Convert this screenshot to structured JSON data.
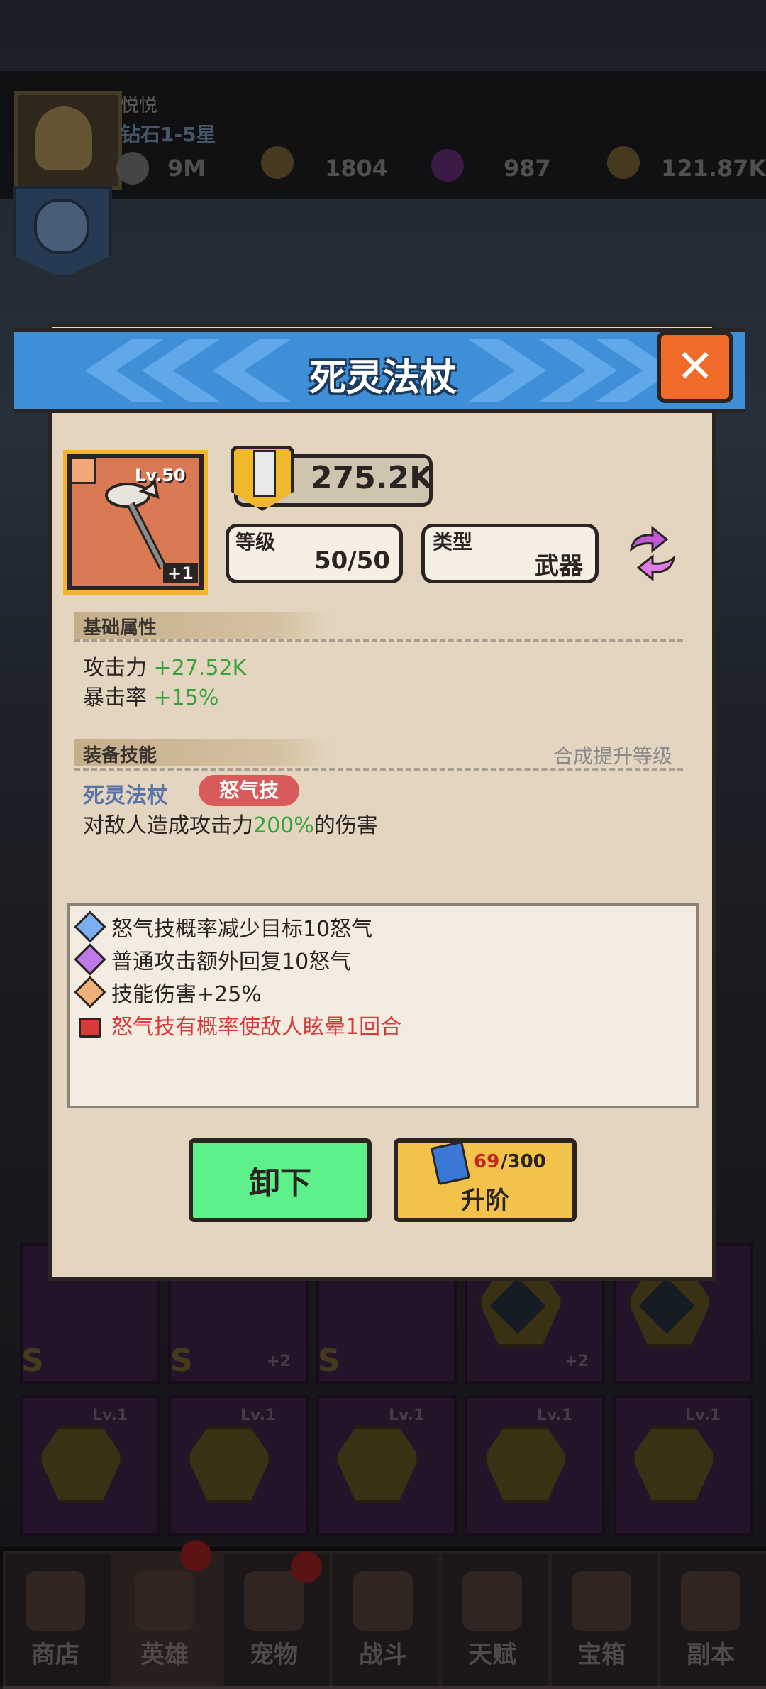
{
  "header": {
    "player_name": "悦悦",
    "rank": "钻石1-5星",
    "resources": [
      {
        "icon": "trophy-icon",
        "value": "9M"
      },
      {
        "icon": "gold-hero-icon",
        "value": "1804"
      },
      {
        "icon": "purple-potion-icon",
        "value": "987"
      },
      {
        "icon": "gold-coin-icon",
        "value": "121.87K"
      }
    ]
  },
  "dialog": {
    "title": "死灵法杖",
    "close_icon": "close-icon",
    "item": {
      "level": "Lv.50",
      "plus": "+1",
      "icon": "necro-staff-icon"
    },
    "power": "275.2K",
    "level_box": {
      "label": "等级",
      "value": "50/50"
    },
    "type_box": {
      "label": "类型",
      "value": "武器"
    },
    "base_attrs": {
      "title": "基础属性",
      "rows": [
        {
          "name": "攻击力",
          "value": "+27.52K"
        },
        {
          "name": "暴击率",
          "value": "+15%"
        }
      ]
    },
    "skill": {
      "title": "装备技能",
      "hint": "合成提升等级",
      "name": "死灵法杖",
      "tag": "怒气技",
      "desc_pre": "对敌人造成攻击力",
      "desc_pct": "200%",
      "desc_post": "的伤害"
    },
    "effects": [
      {
        "text": "怒气技概率减少目标10怒气",
        "color": "#7ab0f0",
        "locked": false
      },
      {
        "text": "普通攻击额外回复10怒气",
        "color": "#c07ae8",
        "locked": false
      },
      {
        "text": "技能伤害+25%",
        "color": "#f0b07a",
        "locked": false
      },
      {
        "text": "怒气技有概率使敌人眩晕1回合",
        "color": "#d83a3a",
        "locked": true
      }
    ],
    "buttons": {
      "unequip": "卸下",
      "upgrade": "升阶",
      "cost_have": "69",
      "cost_need": "/300"
    }
  },
  "grid": {
    "level_labels": [
      "Lv.1",
      "Lv.1",
      "Lv.1",
      "Lv.1",
      "Lv.1"
    ],
    "grade": "S",
    "plus_labels": [
      "+2",
      "+2"
    ]
  },
  "nav": [
    {
      "label": "商店",
      "icon": "shop-icon"
    },
    {
      "label": "英雄",
      "icon": "hero-icon"
    },
    {
      "label": "宠物",
      "icon": "pet-icon"
    },
    {
      "label": "战斗",
      "icon": "battle-icon"
    },
    {
      "label": "天赋",
      "icon": "talent-icon"
    },
    {
      "label": "宝箱",
      "icon": "chest-icon"
    },
    {
      "label": "副本",
      "icon": "dungeon-icon"
    }
  ]
}
